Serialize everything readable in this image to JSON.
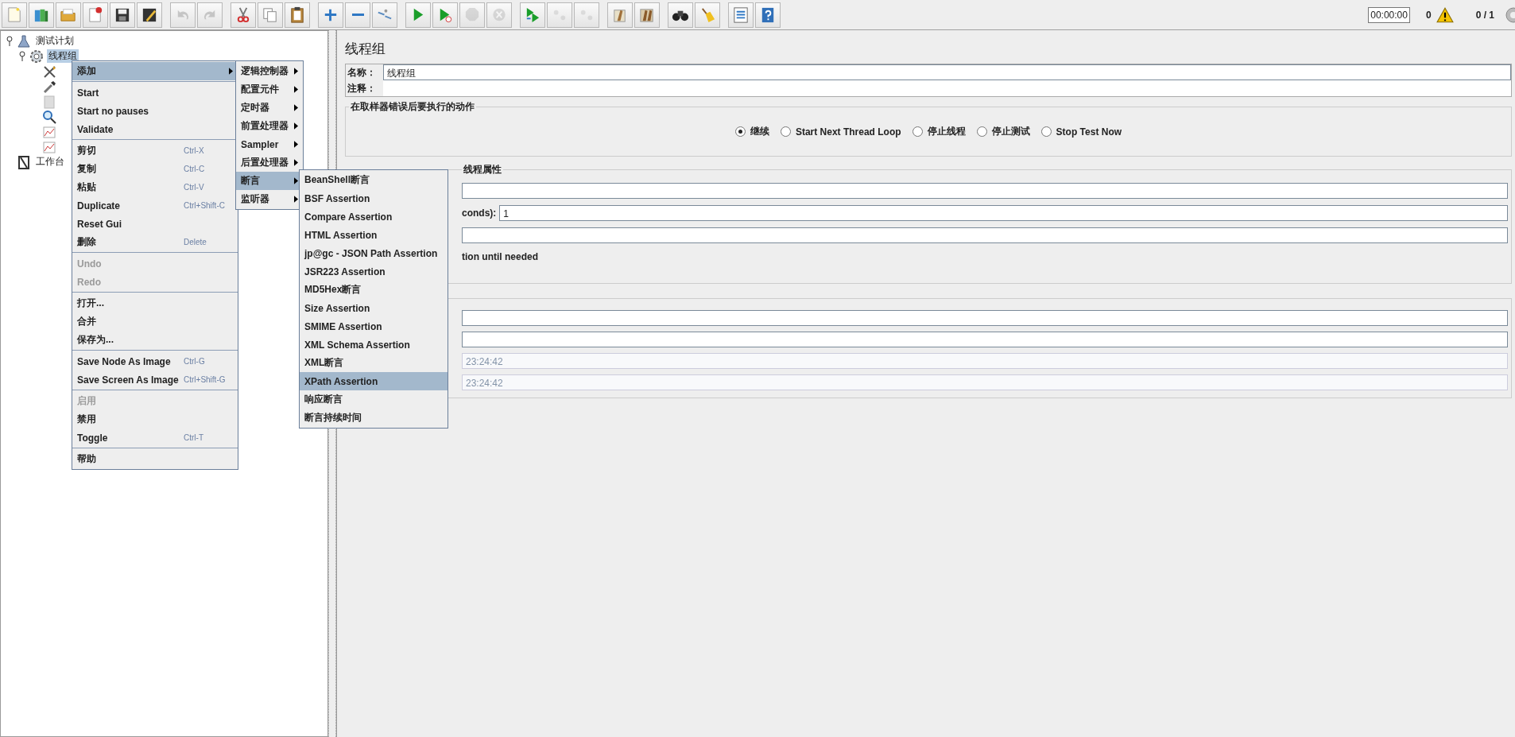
{
  "toolbar": {
    "groups": [
      [
        {
          "kind": "new",
          "disabled": false
        },
        {
          "kind": "templates",
          "disabled": false
        },
        {
          "kind": "open",
          "disabled": false
        },
        {
          "kind": "close",
          "disabled": false
        },
        {
          "kind": "save",
          "disabled": false
        },
        {
          "kind": "save_as",
          "disabled": false
        }
      ],
      [
        {
          "kind": "undo",
          "disabled": true
        },
        {
          "kind": "redo",
          "disabled": true
        }
      ],
      [
        {
          "kind": "cut",
          "disabled": false
        },
        {
          "kind": "copy",
          "disabled": false
        },
        {
          "kind": "paste",
          "disabled": false
        }
      ],
      [
        {
          "kind": "expand",
          "disabled": false
        },
        {
          "kind": "collapse",
          "disabled": false
        },
        {
          "kind": "toggle",
          "disabled": false
        }
      ],
      [
        {
          "kind": "start",
          "disabled": false
        },
        {
          "kind": "start_no_pauses",
          "disabled": false
        },
        {
          "kind": "stop",
          "disabled": true
        },
        {
          "kind": "shutdown",
          "disabled": true
        }
      ],
      [
        {
          "kind": "remote_start",
          "disabled": false
        },
        {
          "kind": "remote_stop",
          "disabled": true
        },
        {
          "kind": "remote_exit",
          "disabled": true
        }
      ],
      [
        {
          "kind": "clear",
          "disabled": false
        },
        {
          "kind": "clear_all",
          "disabled": false
        }
      ],
      [
        {
          "kind": "search",
          "disabled": false
        },
        {
          "kind": "reset_search",
          "disabled": false
        }
      ],
      [
        {
          "kind": "function_helper",
          "disabled": false
        },
        {
          "kind": "help",
          "disabled": false
        }
      ]
    ],
    "timer": "00:00:00",
    "error_count": "0",
    "threads": "0 / 1"
  },
  "tree": [
    {
      "label": "测试计划",
      "kind": "plan",
      "expanded": true,
      "selected": false,
      "children": [
        {
          "label": "线程组",
          "kind": "thread_group",
          "expanded": true,
          "selected": true,
          "children": [
            {
              "kind": "tools"
            },
            {
              "kind": "dropper"
            },
            {
              "kind": "blank"
            },
            {
              "kind": "magnifier"
            },
            {
              "kind": "graph"
            },
            {
              "kind": "graph"
            }
          ]
        }
      ]
    },
    {
      "label": "工作台",
      "kind": "workbench",
      "selected": false
    }
  ],
  "context_menu": {
    "items": [
      {
        "kind": "submenu",
        "label": "添加",
        "selected": true,
        "disabled": false
      },
      {
        "kind": "separator"
      },
      {
        "kind": "item",
        "label": "Start",
        "selected": false,
        "disabled": false
      },
      {
        "kind": "item",
        "label": "Start no pauses",
        "selected": false,
        "disabled": false
      },
      {
        "kind": "item",
        "label": "Validate",
        "selected": false,
        "disabled": false
      },
      {
        "kind": "separator"
      },
      {
        "kind": "item",
        "label": "剪切",
        "shortcut": "Ctrl-X",
        "selected": false,
        "disabled": false
      },
      {
        "kind": "item",
        "label": "复制",
        "shortcut": "Ctrl-C",
        "selected": false,
        "disabled": false
      },
      {
        "kind": "item",
        "label": "粘贴",
        "shortcut": "Ctrl-V",
        "selected": false,
        "disabled": false
      },
      {
        "kind": "item",
        "label": "Duplicate",
        "shortcut": "Ctrl+Shift-C",
        "selected": false,
        "disabled": false
      },
      {
        "kind": "item",
        "label": "Reset Gui",
        "selected": false,
        "disabled": false
      },
      {
        "kind": "item",
        "label": "删除",
        "shortcut": "Delete",
        "selected": false,
        "disabled": false
      },
      {
        "kind": "separator"
      },
      {
        "kind": "item",
        "label": "Undo",
        "selected": false,
        "disabled": true
      },
      {
        "kind": "item",
        "label": "Redo",
        "selected": false,
        "disabled": true
      },
      {
        "kind": "separator"
      },
      {
        "kind": "item",
        "label": "打开...",
        "selected": false,
        "disabled": false
      },
      {
        "kind": "item",
        "label": "合并",
        "selected": false,
        "disabled": false
      },
      {
        "kind": "item",
        "label": "保存为...",
        "selected": false,
        "disabled": false
      },
      {
        "kind": "separator"
      },
      {
        "kind": "item",
        "label": "Save Node As Image",
        "shortcut": "Ctrl-G",
        "selected": false,
        "disabled": false
      },
      {
        "kind": "item",
        "label": "Save Screen As Image",
        "shortcut": "Ctrl+Shift-G",
        "selected": false,
        "disabled": false
      },
      {
        "kind": "separator"
      },
      {
        "kind": "item",
        "label": "启用",
        "selected": false,
        "disabled": true
      },
      {
        "kind": "item",
        "label": "禁用",
        "selected": false,
        "disabled": false
      },
      {
        "kind": "item",
        "label": "Toggle",
        "shortcut": "Ctrl-T",
        "selected": false,
        "disabled": false
      },
      {
        "kind": "separator"
      },
      {
        "kind": "item",
        "label": "帮助",
        "selected": false,
        "disabled": false
      }
    ]
  },
  "add_menu": {
    "items": [
      {
        "label": "逻辑控制器",
        "selected": false
      },
      {
        "label": "配置元件",
        "selected": false
      },
      {
        "label": "定时器",
        "selected": false
      },
      {
        "label": "前置处理器",
        "selected": false
      },
      {
        "label": "Sampler",
        "selected": false
      },
      {
        "label": "后置处理器",
        "selected": false
      },
      {
        "label": "断言",
        "selected": true
      },
      {
        "label": "监听器",
        "selected": false
      }
    ]
  },
  "assertion_menu": {
    "items": [
      {
        "label": "BeanShell断言",
        "selected": false
      },
      {
        "label": "BSF Assertion",
        "selected": false
      },
      {
        "label": "Compare Assertion",
        "selected": false
      },
      {
        "label": "HTML Assertion",
        "selected": false
      },
      {
        "label": "jp@gc - JSON Path Assertion",
        "selected": false
      },
      {
        "label": "JSR223 Assertion",
        "selected": false
      },
      {
        "label": "MD5Hex断言",
        "selected": false
      },
      {
        "label": "Size Assertion",
        "selected": false
      },
      {
        "label": "SMIME Assertion",
        "selected": false
      },
      {
        "label": "XML Schema Assertion",
        "selected": false
      },
      {
        "label": "XML断言",
        "selected": false
      },
      {
        "label": "XPath Assertion",
        "selected": true
      },
      {
        "label": "响应断言",
        "selected": false
      },
      {
        "label": "断言持续时间",
        "selected": false
      }
    ]
  },
  "panel": {
    "title": "线程组",
    "name_label": "名称：",
    "name_value": "线程组",
    "comment_label": "注释：",
    "error_action": {
      "legend": "在取样器错误后要执行的动作",
      "options": [
        {
          "label": "继续",
          "selected": true
        },
        {
          "label": "Start Next Thread Loop",
          "selected": false
        },
        {
          "label": "停止线程",
          "selected": false
        },
        {
          "label": "停止测试",
          "selected": false
        },
        {
          "label": "Stop Test Now",
          "selected": false
        }
      ]
    },
    "thread_properties": {
      "legend": "线程属性",
      "fields": [
        {
          "disabled": false
        },
        {
          "label": "conds):",
          "value": "1",
          "disabled": false
        },
        {
          "disabled": false
        }
      ],
      "checkbox_text": "tion until needed"
    },
    "scheduler": {
      "fields": [
        {
          "disabled": false
        },
        {
          "disabled": false
        },
        {
          "value": "23:24:42",
          "disabled": true
        },
        {
          "value": "23:24:42",
          "disabled": true
        }
      ]
    }
  }
}
